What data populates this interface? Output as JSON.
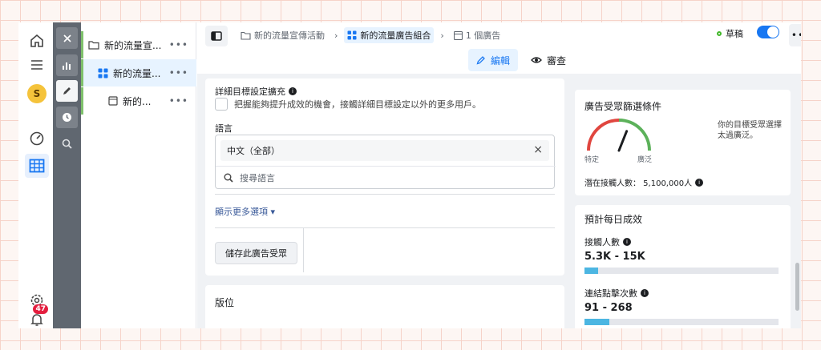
{
  "rail": {
    "avatar_letter": "S",
    "notification_count": "47"
  },
  "tree": {
    "items": [
      {
        "label": "新的流量宣...",
        "more": "•••"
      },
      {
        "label": "新的流量...",
        "more": "•••"
      },
      {
        "label": "新的...",
        "more": "•••"
      }
    ]
  },
  "breadcrumbs": [
    {
      "label": "新的流量宣傳活動"
    },
    {
      "label": "新的流量廣告組合"
    },
    {
      "label": "1 個廣告"
    }
  ],
  "header": {
    "status": "草稿",
    "toggle_on": true,
    "more": "•••",
    "tabs": [
      {
        "label": "編輯",
        "active": true
      },
      {
        "label": "審查",
        "active": false
      }
    ]
  },
  "targeting": {
    "detail_heading": "詳細目標設定擴充",
    "detail_desc": "把握能夠提升成效的機會，接觸詳細目標設定以外的更多用戶。",
    "language_label": "語言",
    "language_value": "中文（全部）",
    "language_search_placeholder": "搜尋語言",
    "show_more": "顯示更多選項",
    "save_audience": "儲存此廣告受眾"
  },
  "placements": {
    "title": "版位"
  },
  "audience": {
    "title": "廣告受眾篩選條件",
    "gauge_left": "特定",
    "gauge_right": "廣泛",
    "gauge_value": 0.62,
    "summary": "你的目標受眾選擇太過廣泛。",
    "potential_reach": "潛在接觸人數： 5,100,000人"
  },
  "daily": {
    "title": "預計每日成效",
    "reach_label": "接觸人數",
    "reach_value": "5.3K - 15K",
    "reach_fill": 0.07,
    "clicks_label": "連結點擊次數",
    "clicks_value": "91 - 268",
    "clicks_fill": 0.13
  },
  "colors": {
    "accent": "#1877f2",
    "status_green": "#42b72a",
    "bar_fill": "#4cb6e2"
  }
}
